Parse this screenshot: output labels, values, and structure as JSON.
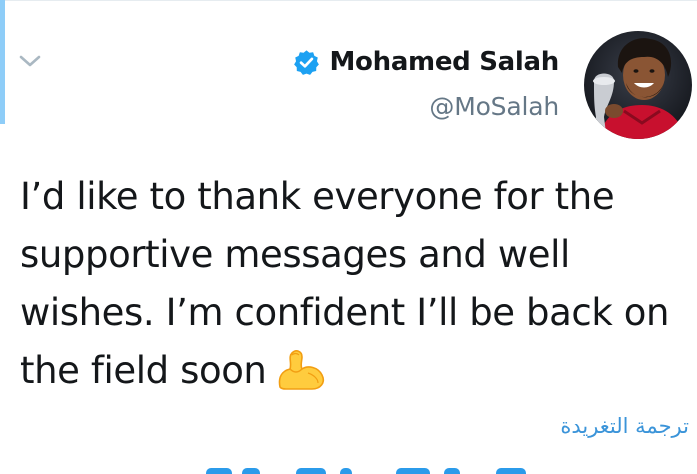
{
  "tweet": {
    "display_name": "Mohamed Salah",
    "handle": "@MoSalah",
    "text": "I’d like to thank everyone for the supportive messages and well wishes. I’m confident I’ll be back on the field soon",
    "emoji": "flexed-biceps",
    "translate_label": "ترجمة التغريدة",
    "verified": true
  },
  "icons": {
    "menu": "chevron-down-icon",
    "verified": "verified-badge-icon"
  },
  "colors": {
    "accent": "#8ecdf8",
    "link": "#3b94d9",
    "verified": "#1da1f2",
    "text": "#14171a",
    "muted": "#657786"
  }
}
